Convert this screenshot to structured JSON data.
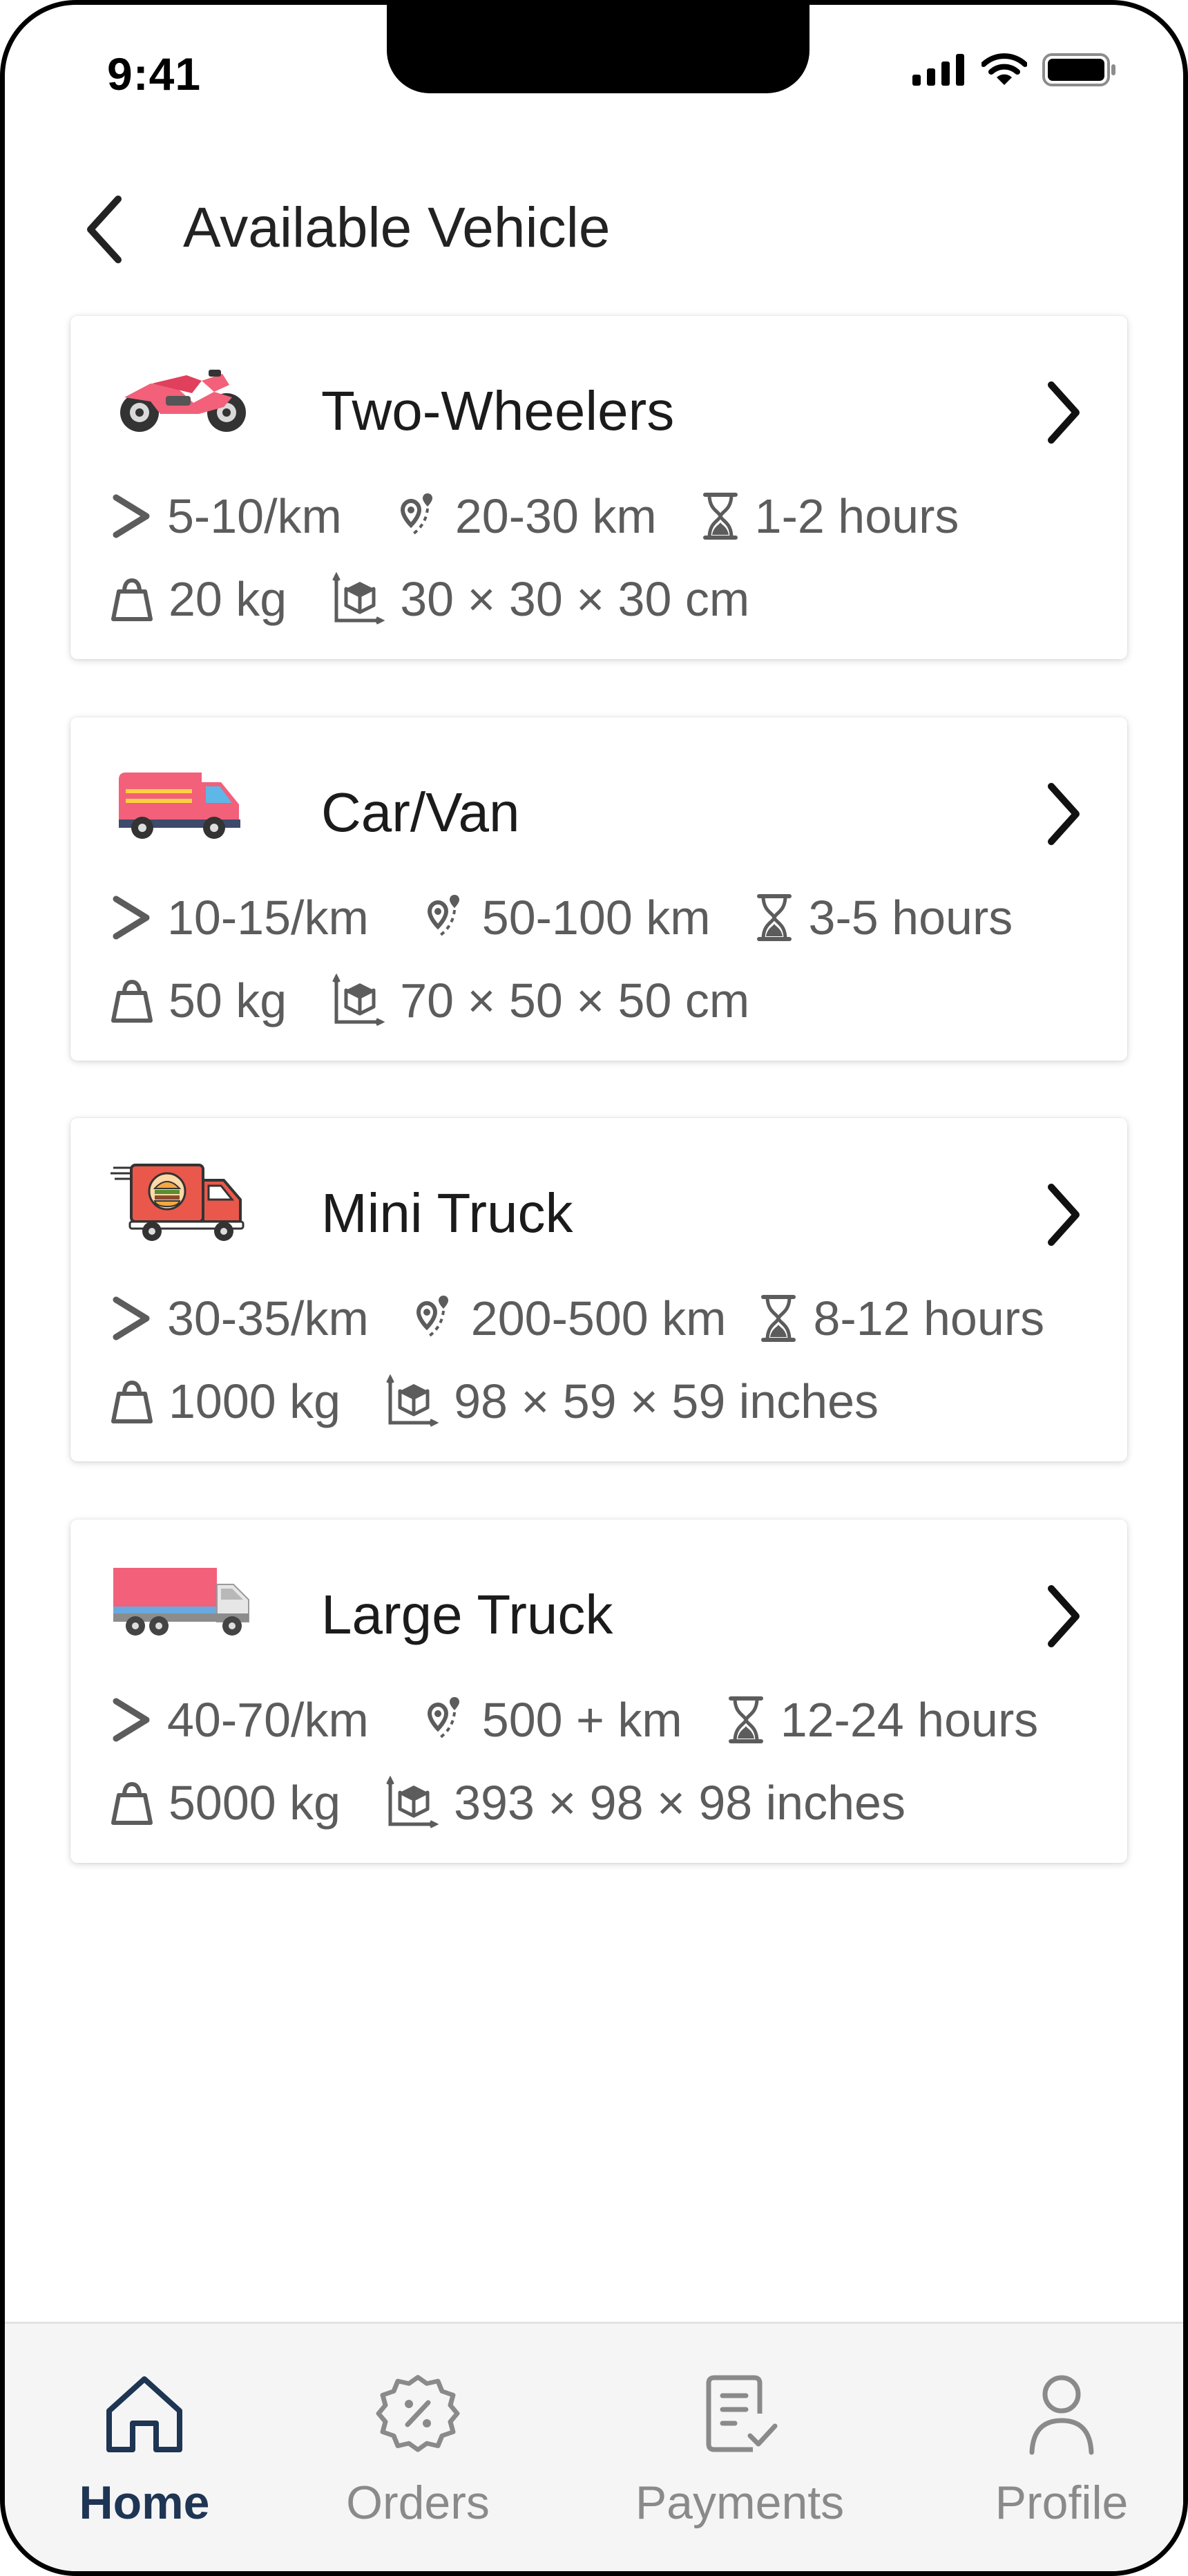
{
  "status_bar": {
    "time": "9:41"
  },
  "header": {
    "title": "Available Vehicle"
  },
  "vehicles": [
    {
      "name": "Two-Wheelers",
      "icon": "motorcycle-icon",
      "rate": "5-10/km",
      "distance": "20-30 km",
      "time": "1-2 hours",
      "weight": "20 kg",
      "dimensions": "30 × 30 × 30 cm"
    },
    {
      "name": "Car/Van",
      "icon": "van-icon",
      "rate": "10-15/km",
      "distance": "50-100 km",
      "time": "3-5 hours",
      "weight": "50 kg",
      "dimensions": "70 × 50 × 50 cm"
    },
    {
      "name": "Mini Truck",
      "icon": "mini-truck-icon",
      "rate": "30-35/km",
      "distance": "200-500 km",
      "time": "8-12 hours",
      "weight": "1000 kg",
      "dimensions": "98 × 59 × 59 inches"
    },
    {
      "name": "Large Truck",
      "icon": "large-truck-icon",
      "rate": "40-70/km",
      "distance": "500 + km",
      "time": "12-24 hours",
      "weight": "5000 kg",
      "dimensions": "393 × 98 × 98 inches"
    }
  ],
  "tabbar": {
    "tabs": [
      {
        "label": "Home",
        "icon": "home-icon",
        "active": true
      },
      {
        "label": "Orders",
        "icon": "discount-badge-icon",
        "active": false
      },
      {
        "label": "Payments",
        "icon": "receipt-check-icon",
        "active": false
      },
      {
        "label": "Profile",
        "icon": "user-icon",
        "active": false
      }
    ]
  },
  "colors": {
    "active_tab": "#1e3553",
    "inactive_tab": "#8a8a8a",
    "vehicle_accent": "#f2607a"
  }
}
